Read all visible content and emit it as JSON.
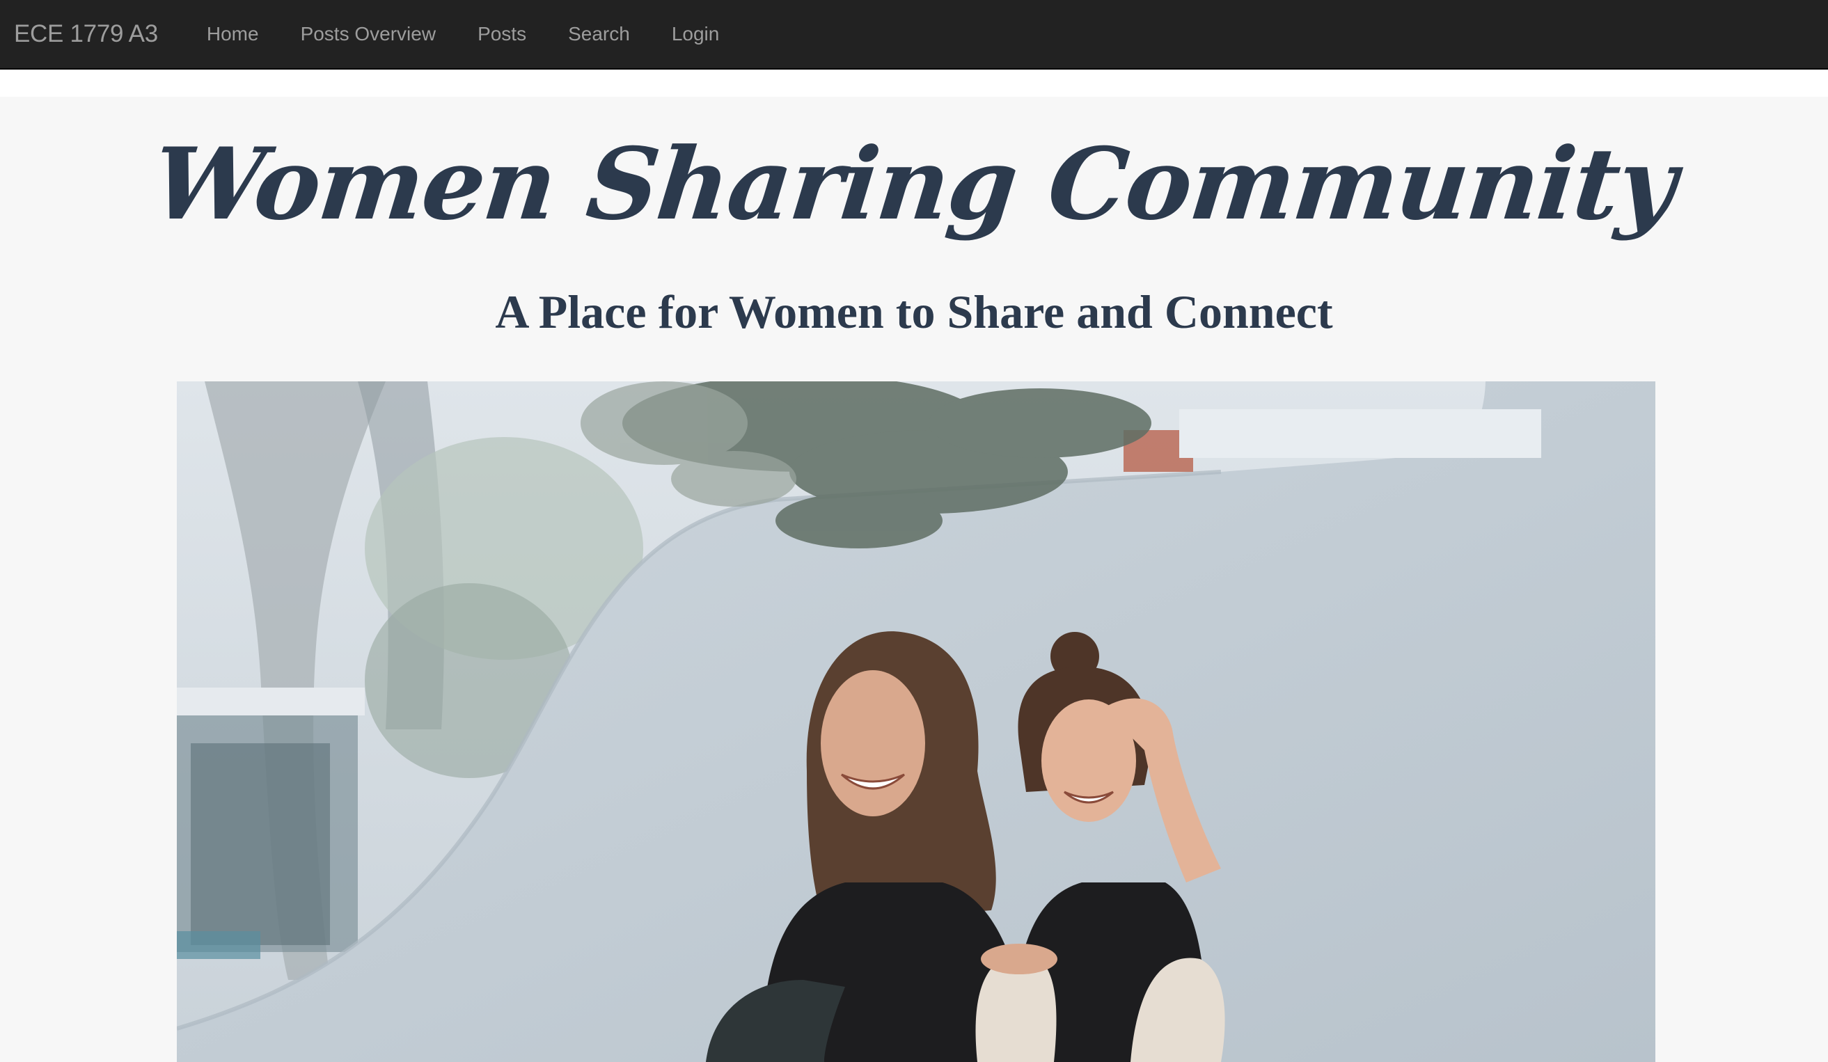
{
  "navbar": {
    "brand": "ECE 1779 A3",
    "links": [
      "Home",
      "Posts Overview",
      "Posts",
      "Search",
      "Login"
    ]
  },
  "hero": {
    "title": "Women Sharing Community",
    "subtitle": "A Place for Women to Share and Connect"
  },
  "photo": {
    "description_icon": "two-women-laughing-photo"
  },
  "colors": {
    "navbar_bg": "#222222",
    "nav_text": "#9d9d9d",
    "hero_bg": "#f7f7f7",
    "heading": "#2c3a4d"
  }
}
